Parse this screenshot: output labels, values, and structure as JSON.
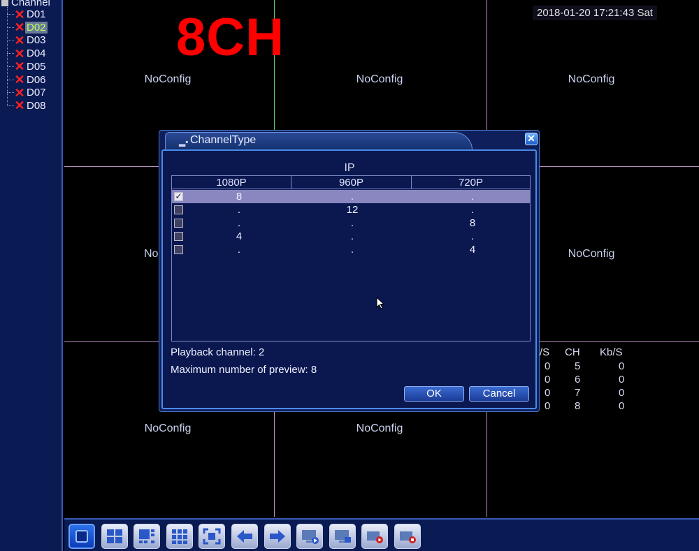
{
  "sidebar": {
    "root_label": "Channel",
    "channels": [
      {
        "label": "D01",
        "selected": false
      },
      {
        "label": "D02",
        "selected": true
      },
      {
        "label": "D03",
        "selected": false
      },
      {
        "label": "D04",
        "selected": false
      },
      {
        "label": "D05",
        "selected": false
      },
      {
        "label": "D06",
        "selected": false
      },
      {
        "label": "D07",
        "selected": false
      },
      {
        "label": "D08",
        "selected": false
      }
    ]
  },
  "clock": "2018-01-20 17:21:43 Sat",
  "banner": "8CH",
  "cells": {
    "c1": "NoConfig",
    "c2": "NoConfig",
    "c3": "NoConfig",
    "c4": "No",
    "c6": "NoConfig",
    "c7": "NoConfig",
    "c8": "NoConfig"
  },
  "bitrate": {
    "col_left_header": "/S",
    "col_ch_header": "CH",
    "col_kbs_header": "Kb/S",
    "rows": [
      {
        "left": "0",
        "ch": "5",
        "kbs": "0"
      },
      {
        "left": "0",
        "ch": "6",
        "kbs": "0"
      },
      {
        "left": "0",
        "ch": "7",
        "kbs": "0"
      },
      {
        "left": "0",
        "ch": "8",
        "kbs": "0"
      }
    ]
  },
  "dialog": {
    "title": "ChannelType",
    "close_glyph": "✕",
    "group_label": "IP",
    "columns": [
      "1080P",
      "960P",
      "720P"
    ],
    "rows": [
      {
        "checked": true,
        "cells": [
          "8",
          ".",
          "."
        ]
      },
      {
        "checked": false,
        "cells": [
          ".",
          "12",
          "."
        ]
      },
      {
        "checked": false,
        "cells": [
          ".",
          ".",
          "8"
        ]
      },
      {
        "checked": false,
        "cells": [
          "4",
          ".",
          "."
        ]
      },
      {
        "checked": false,
        "cells": [
          ".",
          ".",
          "4"
        ]
      }
    ],
    "playback_text": "Playback channel: 2",
    "preview_text": "Maximum number of preview: 8",
    "ok_label": "OK",
    "cancel_label": "Cancel"
  },
  "toolbar": {
    "buttons": [
      "single-view-icon",
      "quad-view-icon",
      "multi-view-icon",
      "nine-view-icon",
      "fullscreen-icon",
      "previous-icon",
      "next-icon",
      "playback-icon",
      "record-screen-icon",
      "record-start-icon",
      "record-stop-icon"
    ]
  },
  "colors": {
    "banner": "#ff0000",
    "dialog_bg": "#0f1f5c",
    "selected_row": "#8a86c0",
    "sidebar_bg": "#0a1a52",
    "grid_line": "#b890c0"
  }
}
